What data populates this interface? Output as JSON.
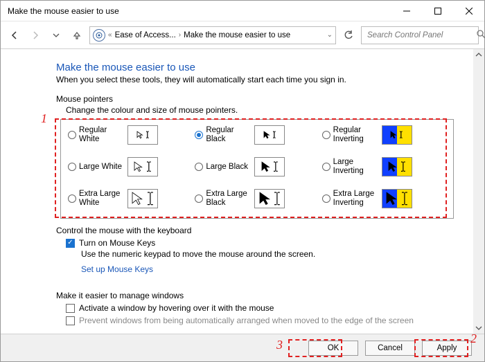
{
  "window": {
    "title": "Make the mouse easier to use"
  },
  "nav": {
    "breadcrumb_root": "Ease of Access...",
    "breadcrumb_leaf": "Make the mouse easier to use",
    "search_placeholder": "Search Control Panel"
  },
  "page": {
    "title": "Make the mouse easier to use",
    "subtitle": "When you select these tools, they will automatically start each time you sign in."
  },
  "pointers": {
    "section": "Mouse pointers",
    "sub": "Change the colour and size of mouse pointers.",
    "selected": "regular_black",
    "options": [
      {
        "id": "regular_white",
        "label": "Regular White",
        "size": "reg",
        "theme": "white"
      },
      {
        "id": "regular_black",
        "label": "Regular Black",
        "size": "reg",
        "theme": "black"
      },
      {
        "id": "regular_inverting",
        "label": "Regular Inverting",
        "size": "reg",
        "theme": "inv"
      },
      {
        "id": "large_white",
        "label": "Large White",
        "size": "lg",
        "theme": "white"
      },
      {
        "id": "large_black",
        "label": "Large Black",
        "size": "lg",
        "theme": "black"
      },
      {
        "id": "large_inverting",
        "label": "Large Inverting",
        "size": "lg",
        "theme": "inv"
      },
      {
        "id": "xl_white",
        "label": "Extra Large White",
        "size": "xl",
        "theme": "white"
      },
      {
        "id": "xl_black",
        "label": "Extra Large Black",
        "size": "xl",
        "theme": "black"
      },
      {
        "id": "xl_inverting",
        "label": "Extra Large Inverting",
        "size": "xl",
        "theme": "inv"
      }
    ]
  },
  "keyboard": {
    "section": "Control the mouse with the keyboard",
    "mouse_keys_label": "Turn on Mouse Keys",
    "mouse_keys_checked": true,
    "desc": "Use the numeric keypad to move the mouse around the screen.",
    "link": "Set up Mouse Keys"
  },
  "windows_mgmt": {
    "section": "Make it easier to manage windows",
    "hover_label": "Activate a window by hovering over it with the mouse",
    "hover_checked": false,
    "prevent_label": "Prevent windows from being automatically arranged when moved to the edge of the screen",
    "prevent_checked": false
  },
  "buttons": {
    "ok": "OK",
    "cancel": "Cancel",
    "apply": "Apply"
  },
  "annotations": {
    "n1": "1",
    "n2": "2",
    "n3": "3"
  }
}
